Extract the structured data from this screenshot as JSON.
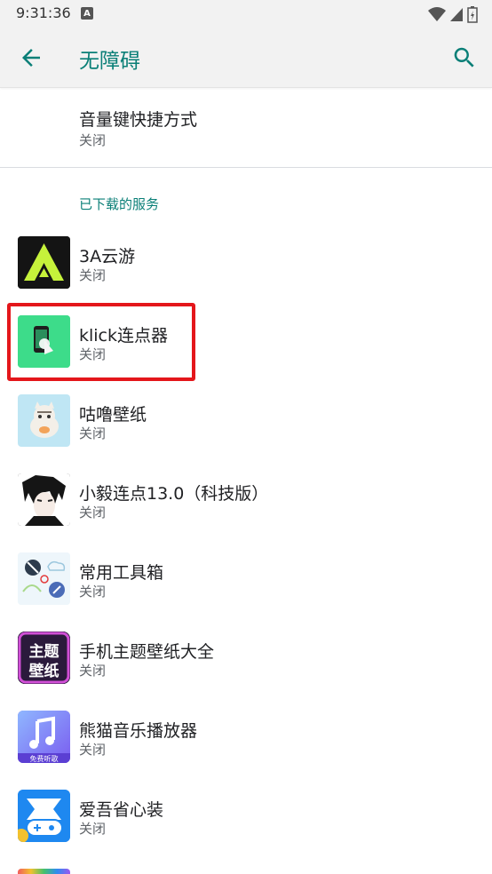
{
  "status_bar": {
    "time": "9:31:36",
    "notif_letter": "A"
  },
  "app_bar": {
    "title": "无障碍"
  },
  "volume_shortcut": {
    "title": "音量键快捷方式",
    "status": "关闭"
  },
  "downloaded_services": {
    "header": "已下载的服务",
    "items": [
      {
        "title": "3A云游",
        "status": "关闭",
        "icon": "3a-cloud-game-icon"
      },
      {
        "title": "klick连点器",
        "status": "关闭",
        "icon": "klick-clicker-icon"
      },
      {
        "title": "咕噜壁纸",
        "status": "关闭",
        "icon": "cat-wallpaper-icon"
      },
      {
        "title": "小毅连点13.0（科技版）",
        "status": "关闭",
        "icon": "anime-avatar-icon"
      },
      {
        "title": "常用工具箱",
        "status": "关闭",
        "icon": "toolbox-icon"
      },
      {
        "title": "手机主题壁纸大全",
        "status": "关闭",
        "icon": "theme-wallpaper-icon",
        "icon_text": "主题壁纸"
      },
      {
        "title": "熊猫音乐播放器",
        "status": "关闭",
        "icon": "music-player-icon",
        "icon_text": "免费听歌"
      },
      {
        "title": "爱吾省心装",
        "status": "关闭",
        "icon": "aiwu-installer-icon"
      }
    ]
  },
  "colors": {
    "accent": "#0a7f77",
    "highlight": "#e4161b"
  }
}
